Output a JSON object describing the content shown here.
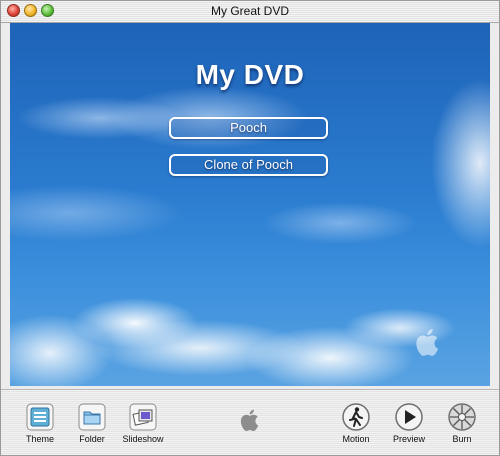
{
  "window": {
    "title": "My Great DVD"
  },
  "menu": {
    "title": "My DVD",
    "buttons": [
      "Pooch",
      "Clone of Pooch"
    ]
  },
  "toolbar": {
    "theme": "Theme",
    "folder": "Folder",
    "slideshow": "Slideshow",
    "motion": "Motion",
    "preview": "Preview",
    "burn": "Burn"
  },
  "icons": {
    "close": "close-button-icon",
    "minimize": "minimize-button-icon",
    "zoom": "zoom-button-icon",
    "theme": "theme-icon",
    "folder": "folder-icon",
    "slideshow": "slideshow-icon",
    "apple": "apple-logo-icon",
    "motion": "motion-icon",
    "preview": "play-icon",
    "burn": "burn-disc-icon"
  },
  "colors": {
    "sky_top": "#1e63b8",
    "sky_bottom": "#5aa3e2",
    "menu_text": "#ffffff"
  }
}
